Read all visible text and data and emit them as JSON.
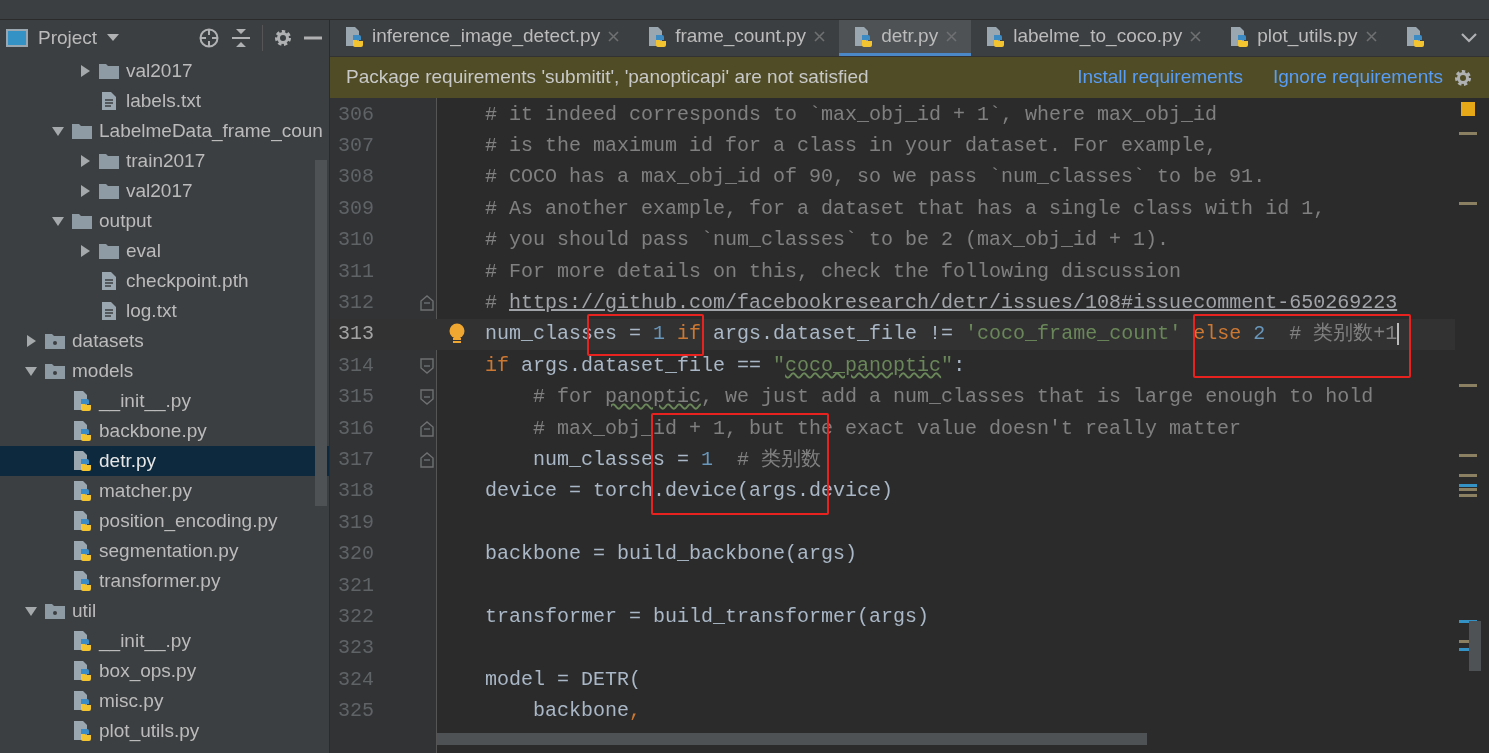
{
  "project_panel": {
    "title": "Project",
    "tree": [
      {
        "children": [
          {
            "children": [
              {
                "label": "val2017",
                "kind": "folder",
                "expanded": false,
                "selected": false
              },
              {
                "label": "labels.txt",
                "kind": "text",
                "selected": false
              }
            ]
          },
          {
            "label": "LabelmeData_frame_coun",
            "kind": "folder",
            "expanded": true,
            "selected": false,
            "children": [
              {
                "label": "train2017",
                "kind": "folder",
                "expanded": false,
                "selected": false
              },
              {
                "label": "val2017",
                "kind": "folder",
                "expanded": false,
                "selected": false
              }
            ]
          },
          {
            "label": "output",
            "kind": "folder",
            "expanded": true,
            "selected": false,
            "children": [
              {
                "label": "eval",
                "kind": "folder",
                "expanded": false,
                "selected": false
              },
              {
                "label": "checkpoint.pth",
                "kind": "text",
                "selected": false
              },
              {
                "label": "log.txt",
                "kind": "text",
                "selected": false
              }
            ]
          }
        ]
      },
      {
        "label": "datasets",
        "kind": "package",
        "expanded": false,
        "selected": false
      },
      {
        "label": "models",
        "kind": "package",
        "expanded": true,
        "selected": false,
        "children": [
          {
            "label": "__init__.py",
            "kind": "python",
            "selected": false
          },
          {
            "label": "backbone.py",
            "kind": "python",
            "selected": false
          },
          {
            "label": "detr.py",
            "kind": "python",
            "selected": true
          },
          {
            "label": "matcher.py",
            "kind": "python",
            "selected": false
          },
          {
            "label": "position_encoding.py",
            "kind": "python",
            "selected": false
          },
          {
            "label": "segmentation.py",
            "kind": "python",
            "selected": false
          },
          {
            "label": "transformer.py",
            "kind": "python",
            "selected": false
          }
        ]
      },
      {
        "label": "util",
        "kind": "package",
        "expanded": true,
        "selected": false,
        "children": [
          {
            "label": "__init__.py",
            "kind": "python",
            "selected": false
          },
          {
            "label": "box_ops.py",
            "kind": "python",
            "selected": false
          },
          {
            "label": "misc.py",
            "kind": "python",
            "selected": false
          },
          {
            "label": "plot_utils.py",
            "kind": "python",
            "selected": false
          }
        ]
      }
    ]
  },
  "tabs": [
    {
      "label": "inference_image_detect.py",
      "selected": false
    },
    {
      "label": "frame_count.py",
      "selected": false
    },
    {
      "label": "detr.py",
      "selected": true
    },
    {
      "label": "labelme_to_coco.py",
      "selected": false
    },
    {
      "label": "plot_utils.py",
      "selected": false
    },
    {
      "selected": false
    }
  ],
  "banner": {
    "message": "Package requirements 'submitit', 'panopticapi' are not satisfied",
    "links": [
      "Install requirements",
      "Ignore requirements"
    ]
  },
  "code": [
    {
      "number": "306",
      "tokens": [
        {
          "kind": "comment",
          "text": "# it indeed corresponds to `max_obj_id + 1`, where max_obj_id"
        }
      ]
    },
    {
      "number": "307",
      "tokens": [
        {
          "kind": "comment",
          "text": "# is the maximum id for a class in your dataset. For example,"
        }
      ]
    },
    {
      "number": "308",
      "tokens": [
        {
          "kind": "comment",
          "text": "# COCO has a max_obj_id of 90, so we pass `num_classes` to be 91."
        }
      ]
    },
    {
      "number": "309",
      "tokens": [
        {
          "kind": "comment",
          "text": "# As another example, for a dataset that has a single class with id 1,"
        }
      ]
    },
    {
      "number": "310",
      "tokens": [
        {
          "kind": "comment",
          "text": "# you should pass `num_classes` to be 2 (max_obj_id + 1)."
        }
      ]
    },
    {
      "number": "311",
      "tokens": [
        {
          "kind": "comment",
          "text": "# For more details on this, check the following discussion"
        }
      ]
    },
    {
      "number": "312",
      "kind": "fold_close",
      "tokens": [
        {
          "kind": "comment",
          "text": "# "
        },
        {
          "kind": "link",
          "text": "https://github.com/facebookresearch/detr/issues/108#issuecomment-650269223"
        }
      ]
    },
    {
      "number": "313",
      "current": true,
      "bulb": true,
      "caret": true,
      "tokens": [
        {
          "kind": "plain",
          "text": "num_classes = "
        },
        {
          "kind": "number",
          "text": "1"
        },
        {
          "kind": "keyword",
          "text": " if"
        },
        {
          "kind": "plain",
          "text": " args.dataset_file != "
        },
        {
          "kind": "string",
          "text": "'coco_frame_count'"
        },
        {
          "kind": "keyword",
          "text": " else"
        },
        {
          "kind": "number",
          "text": " 2"
        },
        {
          "kind": "comment",
          "text": "  # 类别数+1"
        }
      ]
    },
    {
      "number": "314",
      "kind": "fold_open",
      "tokens": [
        {
          "kind": "keyword",
          "text": "if"
        },
        {
          "kind": "plain",
          "text": " args.dataset_file == "
        },
        {
          "kind": "string",
          "text": "\""
        },
        {
          "kind": "string",
          "text": "coco_panoptic",
          "typo": true
        },
        {
          "kind": "string",
          "text": "\""
        },
        {
          "kind": "plain",
          "text": ":"
        }
      ]
    },
    {
      "number": "315",
      "kind": "fold_open",
      "tokens": [
        {
          "kind": "comment",
          "text": "    # for "
        },
        {
          "kind": "comment",
          "text": "panoptic",
          "typo": true
        },
        {
          "kind": "comment",
          "text": ", we just add a num_classes that is large enough to hold"
        }
      ]
    },
    {
      "number": "316",
      "kind": "fold_close",
      "tokens": [
        {
          "kind": "comment",
          "text": "    # max_obj_id + 1, but the exact value doesn't really matter"
        }
      ]
    },
    {
      "number": "317",
      "kind": "fold_close",
      "tokens": [
        {
          "kind": "plain",
          "text": "    num_classes = "
        },
        {
          "kind": "number",
          "text": "1"
        },
        {
          "kind": "comment",
          "text": "  # 类别数"
        }
      ]
    },
    {
      "number": "318",
      "tokens": [
        {
          "kind": "plain",
          "text": "device = torch.device(args.device)"
        }
      ]
    },
    {
      "number": "319"
    },
    {
      "number": "320",
      "tokens": [
        {
          "kind": "plain",
          "text": "backbone = build_backbone(args)"
        }
      ]
    },
    {
      "number": "321"
    },
    {
      "number": "322",
      "tokens": [
        {
          "kind": "plain",
          "text": "transformer = build_transformer(args)"
        }
      ]
    },
    {
      "number": "323"
    },
    {
      "number": "324",
      "tokens": [
        {
          "kind": "plain",
          "text": "model = DETR("
        }
      ]
    },
    {
      "number": "325",
      "tokens": [
        {
          "kind": "plain",
          "text": "    backbone"
        },
        {
          "kind": "keyword",
          "text": ","
        }
      ]
    }
  ]
}
